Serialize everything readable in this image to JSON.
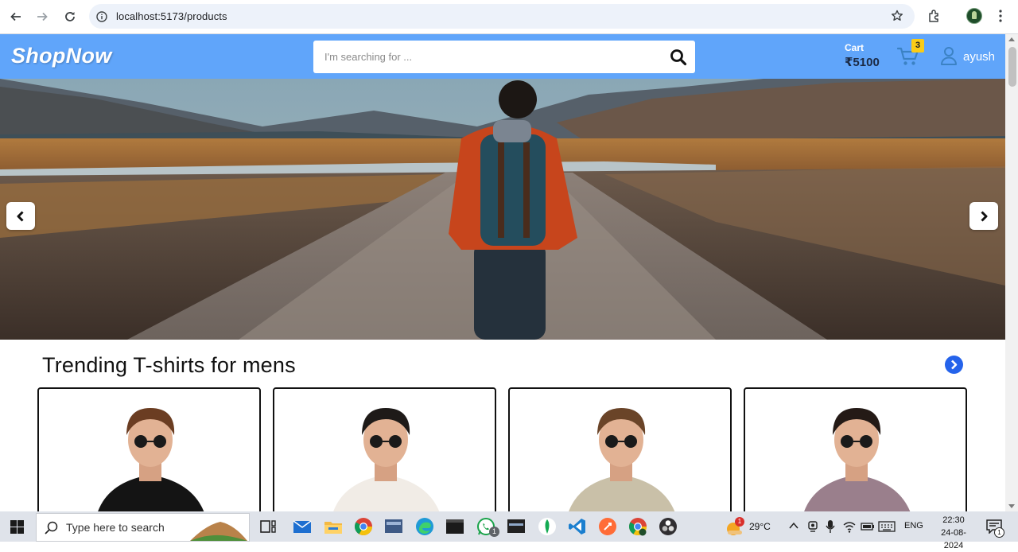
{
  "browser": {
    "url": "localhost:5173/products"
  },
  "site": {
    "logo": "ShopNow",
    "search_placeholder": "I'm searching for ...",
    "cart": {
      "label": "Cart",
      "total": "₹5100",
      "count": "3"
    },
    "user": {
      "name": "ayush"
    }
  },
  "section": {
    "title": "Trending T-shirts for mens"
  },
  "products": [
    {
      "shirt_color": "#141414",
      "hair_color": "#6b3d22"
    },
    {
      "shirt_color": "#f1ece6",
      "hair_color": "#1e1a18"
    },
    {
      "shirt_color": "#c9c0a8",
      "hair_color": "#6a4428"
    },
    {
      "shirt_color": "#9a7f8c",
      "hair_color": "#241a16"
    }
  ],
  "taskbar": {
    "search_placeholder": "Type here to search",
    "weather": "29°C",
    "language": "ENG",
    "time": "22:30",
    "date": "24-08-2024",
    "whatsapp_badge": "1",
    "notifications_badge": "1",
    "weather_badge": "1"
  },
  "colors": {
    "header_bg": "#60a5fa",
    "badge": "#facc15",
    "section_arrow": "#2563eb"
  }
}
